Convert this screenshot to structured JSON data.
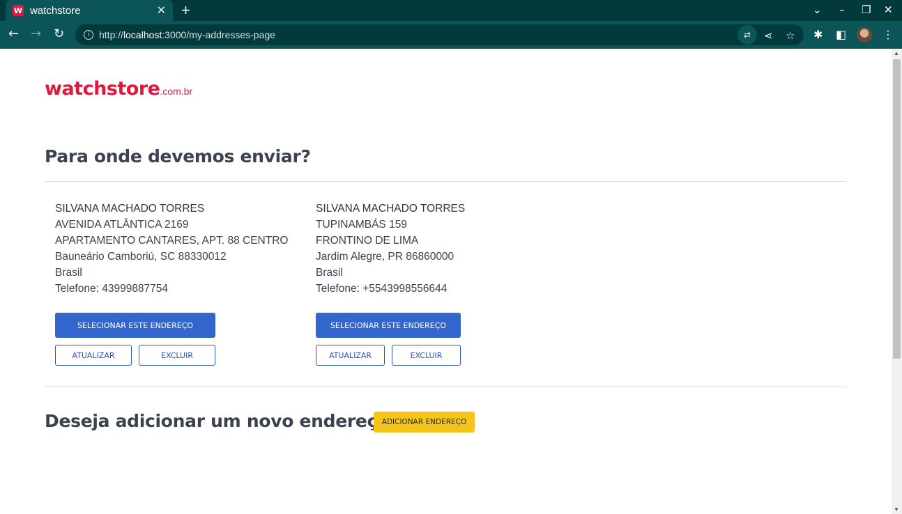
{
  "browser": {
    "tab_title": "watchstore",
    "favicon_letter": "W",
    "url_scheme": "http://",
    "url_host": "localhost",
    "url_path": ":3000/my-addresses-page"
  },
  "logo": {
    "main": "watchstore",
    "suffix": ".com.br"
  },
  "shipping": {
    "title": "Para onde devemos enviar?",
    "addresses": [
      {
        "name": "SILVANA MACHADO TORRES",
        "street": "AVENIDA ATLÂNTICA 2169",
        "complement": "APARTAMENTO CANTARES, APT. 88 CENTRO",
        "city_line": "Bauneário Camboriú, SC 88330012",
        "country": "Brasil",
        "phone": "Telefone: 43999887754",
        "select_label": "SELECIONAR ESTE ENDEREÇO",
        "update_label": "ATUALIZAR",
        "delete_label": "EXCLUIR"
      },
      {
        "name": "SILVANA MACHADO TORRES",
        "street": "TUPINAMBÁS 159",
        "complement": "FRONTINO DE LIMA",
        "city_line": "Jardim Alegre, PR 86860000",
        "country": "Brasil",
        "phone": "Telefone: +5543998556644",
        "select_label": "SELECIONAR ESTE ENDEREÇO",
        "update_label": "ATUALIZAR",
        "delete_label": "EXCLUIR"
      }
    ]
  },
  "new_address": {
    "title": "Deseja adicionar um novo endereço?",
    "button_label": "ADICIONAR ENDEREÇO"
  },
  "colors": {
    "brand": "#e3173d",
    "primary_button": "#3366cc",
    "add_button": "#f5c518",
    "chrome": "#0b5457"
  }
}
